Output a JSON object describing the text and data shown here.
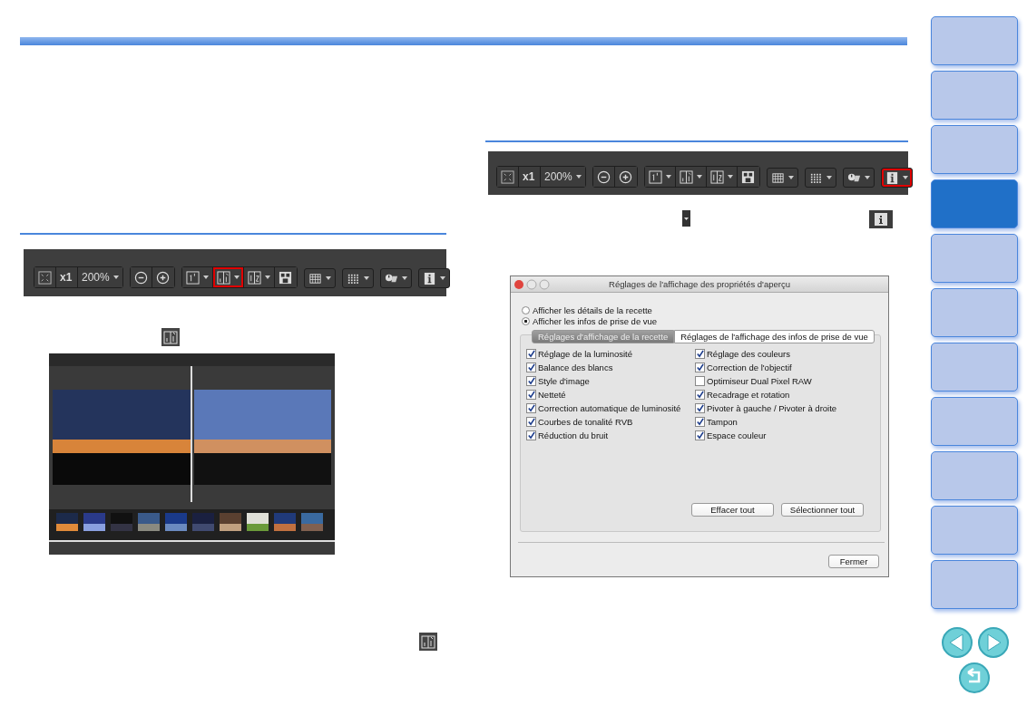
{
  "toolbars": [
    {
      "buttons": [
        {
          "kind": "fit",
          "highlighted": false
        },
        {
          "kind": "actual",
          "label": "x1",
          "highlighted": false
        },
        {
          "kind": "zoom",
          "label": "200%",
          "highlighted": false
        },
        {
          "kind": "zoom-out",
          "highlighted": false
        },
        {
          "kind": "zoom-in",
          "highlighted": false
        },
        {
          "kind": "single-view",
          "highlighted": false
        },
        {
          "kind": "compare-view",
          "highlighted": true
        },
        {
          "kind": "split-view",
          "highlighted": false
        },
        {
          "kind": "multi-view",
          "highlighted": false
        },
        {
          "kind": "grid",
          "highlighted": false
        },
        {
          "kind": "af-points",
          "highlighted": false
        },
        {
          "kind": "highlight",
          "highlighted": false
        },
        {
          "kind": "info",
          "highlighted": false
        }
      ]
    },
    {
      "buttons": [
        {
          "kind": "fit",
          "highlighted": false
        },
        {
          "kind": "actual",
          "label": "x1",
          "highlighted": false
        },
        {
          "kind": "zoom",
          "label": "200%",
          "highlighted": false
        },
        {
          "kind": "zoom-out",
          "highlighted": false
        },
        {
          "kind": "zoom-in",
          "highlighted": false
        },
        {
          "kind": "single-view",
          "highlighted": false
        },
        {
          "kind": "compare-view",
          "highlighted": false
        },
        {
          "kind": "split-view",
          "highlighted": false
        },
        {
          "kind": "multi-view",
          "highlighted": false
        },
        {
          "kind": "grid",
          "highlighted": false
        },
        {
          "kind": "af-points",
          "highlighted": false
        },
        {
          "kind": "highlight",
          "highlighted": false
        },
        {
          "kind": "info",
          "highlighted": true
        }
      ]
    }
  ],
  "dialog": {
    "title": "Réglages de l'affichage des propriétés d'aperçu",
    "radios": [
      {
        "label": "Afficher les détails de la recette",
        "selected": false
      },
      {
        "label": "Afficher les infos de prise de vue",
        "selected": true
      }
    ],
    "tabs": [
      {
        "label": "Réglages d'affichage de la recette",
        "selected": true
      },
      {
        "label": "Réglages de l'affichage des infos de prise de vue",
        "selected": false
      }
    ],
    "left_column": [
      {
        "label": "Réglage de la luminosité",
        "checked": true
      },
      {
        "label": "Balance des blancs",
        "checked": true
      },
      {
        "label": "Style d'image",
        "checked": true
      },
      {
        "label": "Netteté",
        "checked": true
      },
      {
        "label": "Correction automatique de luminosité",
        "checked": true
      },
      {
        "label": "Courbes de tonalité RVB",
        "checked": true
      },
      {
        "label": "Réduction du bruit",
        "checked": true
      }
    ],
    "right_column": [
      {
        "label": "Réglage des couleurs",
        "checked": true
      },
      {
        "label": "Correction de l'objectif",
        "checked": true
      },
      {
        "label": "Optimiseur Dual Pixel RAW",
        "checked": false
      },
      {
        "label": "Recadrage et rotation",
        "checked": true
      },
      {
        "label": "Pivoter à gauche / Pivoter à droite",
        "checked": true
      },
      {
        "label": "Tampon",
        "checked": true
      },
      {
        "label": "Espace couleur",
        "checked": true
      }
    ],
    "panel_buttons": [
      "Effacer tout",
      "Sélectionner tout"
    ],
    "close_button": "Fermer"
  },
  "nav_tabs": [
    {
      "selected": false
    },
    {
      "selected": false
    },
    {
      "selected": false
    },
    {
      "selected": true
    },
    {
      "selected": false
    },
    {
      "selected": false
    },
    {
      "selected": false
    },
    {
      "selected": false
    },
    {
      "selected": false
    },
    {
      "selected": false
    },
    {
      "selected": false
    }
  ]
}
